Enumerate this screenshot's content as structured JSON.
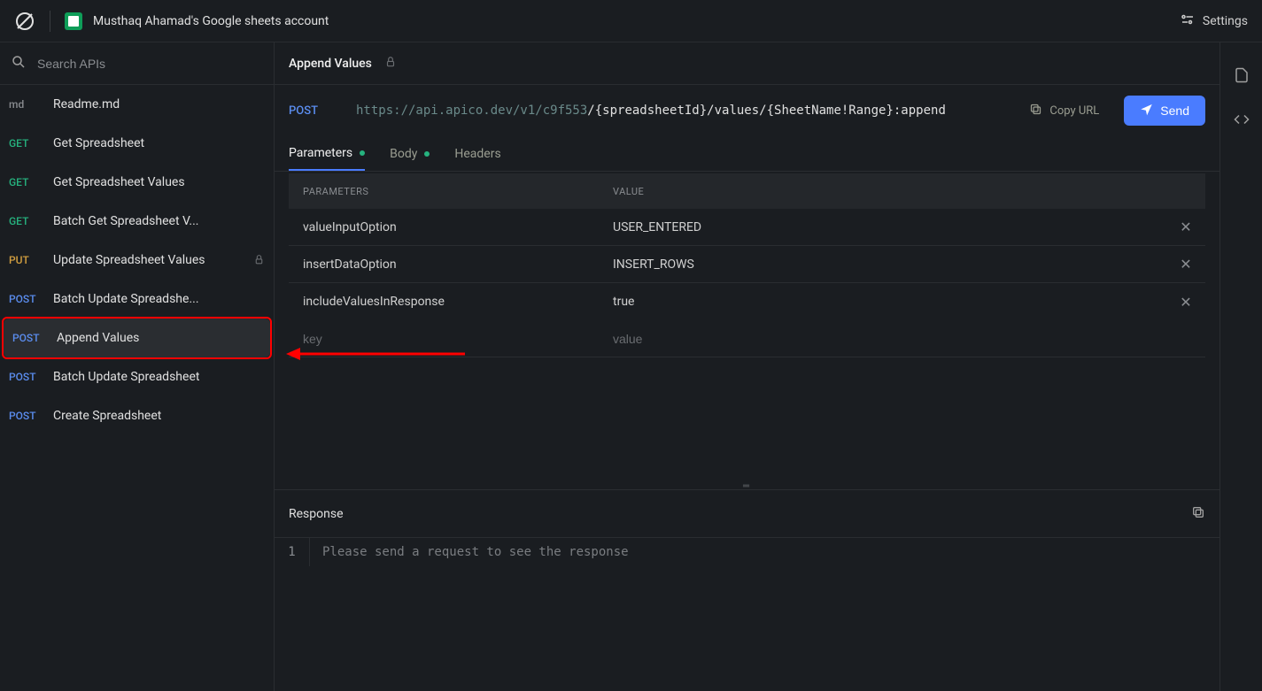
{
  "header": {
    "account_title": "Musthaq Ahamad's Google sheets account",
    "settings_label": "Settings"
  },
  "sidebar": {
    "search_placeholder": "Search APIs",
    "items": [
      {
        "method": "md",
        "label": "Readme.md",
        "locked": false
      },
      {
        "method": "GET",
        "label": "Get Spreadsheet",
        "locked": false
      },
      {
        "method": "GET",
        "label": "Get Spreadsheet Values",
        "locked": false
      },
      {
        "method": "GET",
        "label": "Batch Get Spreadsheet V...",
        "locked": false
      },
      {
        "method": "PUT",
        "label": "Update Spreadsheet Values",
        "locked": true
      },
      {
        "method": "POST",
        "label": "Batch Update Spreadshe...",
        "locked": false
      },
      {
        "method": "POST",
        "label": "Append Values",
        "locked": false,
        "active": true
      },
      {
        "method": "POST",
        "label": "Batch Update Spreadsheet",
        "locked": false
      },
      {
        "method": "POST",
        "label": "Create Spreadsheet",
        "locked": false
      }
    ]
  },
  "main": {
    "title": "Append Values",
    "method": "POST",
    "url_base": "https://api.apico.dev/v1/c9f553",
    "url_path": "/{spreadsheetId}/values/{SheetName!Range}:append",
    "copy_url": "Copy URL",
    "send": "Send",
    "tabs": [
      {
        "label": "Parameters",
        "dot": true,
        "active": true
      },
      {
        "label": "Body",
        "dot": true,
        "active": false
      },
      {
        "label": "Headers",
        "dot": false,
        "active": false
      }
    ],
    "params_header": {
      "col1": "PARAMETERS",
      "col2": "VALUE"
    },
    "params": [
      {
        "key": "valueInputOption",
        "value": "USER_ENTERED"
      },
      {
        "key": "insertDataOption",
        "value": "INSERT_ROWS"
      },
      {
        "key": "includeValuesInResponse",
        "value": "true"
      }
    ],
    "new_param": {
      "key_placeholder": "key",
      "value_placeholder": "value"
    },
    "response": {
      "title": "Response",
      "line_no": "1",
      "placeholder": "Please send a request to see the response"
    }
  }
}
